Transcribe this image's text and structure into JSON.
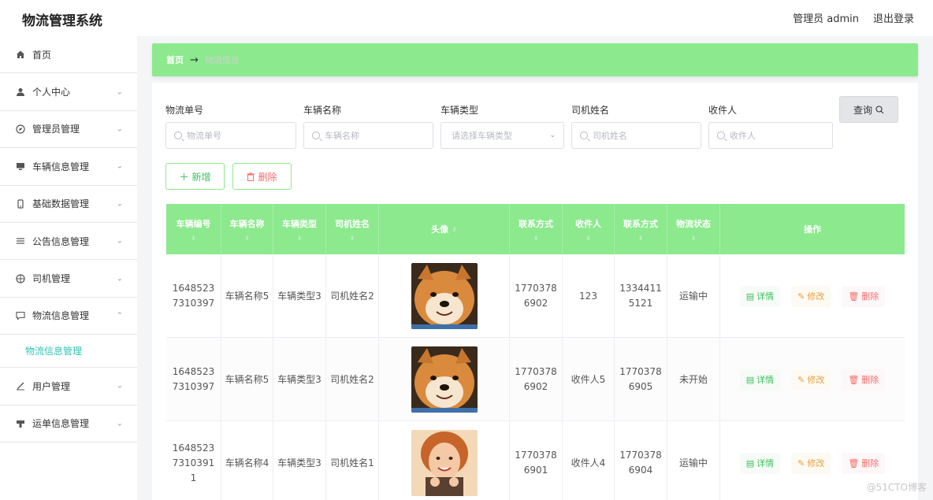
{
  "header": {
    "title": "物流管理系统",
    "user_label": "管理员 admin",
    "logout_label": "退出登录"
  },
  "sidebar": {
    "items": [
      {
        "label": "首页",
        "icon": "home-icon"
      },
      {
        "label": "个人中心",
        "icon": "user-icon"
      },
      {
        "label": "管理员管理",
        "icon": "compass-icon"
      },
      {
        "label": "车辆信息管理",
        "icon": "monitor-icon"
      },
      {
        "label": "基础数据管理",
        "icon": "phone-icon"
      },
      {
        "label": "公告信息管理",
        "icon": "list-icon"
      },
      {
        "label": "司机管理",
        "icon": "target-icon"
      },
      {
        "label": "物流信息管理",
        "icon": "message-icon"
      },
      {
        "label": "用户管理",
        "icon": "pen-icon"
      },
      {
        "label": "运单信息管理",
        "icon": "stamp-icon"
      }
    ],
    "sub_item": "物流信息管理"
  },
  "breadcrumb": {
    "home": "首页",
    "arrow": "→",
    "current": "物流信息"
  },
  "search": {
    "fields": [
      {
        "label": "物流单号",
        "placeholder": "物流单号"
      },
      {
        "label": "车辆名称",
        "placeholder": "车辆名称"
      },
      {
        "label": "车辆类型",
        "placeholder": "请选择车辆类型"
      },
      {
        "label": "司机姓名",
        "placeholder": "司机姓名"
      },
      {
        "label": "收件人",
        "placeholder": "收件人"
      }
    ],
    "query_label": "查询"
  },
  "actions": {
    "add_label": "新增",
    "delete_label": "删除"
  },
  "table": {
    "headers": [
      "车辆编号",
      "车辆名称",
      "车辆类型",
      "司机姓名",
      "头像",
      "联系方式",
      "收件人",
      "联系方式",
      "物流状态",
      "操作"
    ],
    "rows": [
      {
        "vehicle_no": "16485237310397",
        "vehicle_name": "车辆名称5",
        "vehicle_type": "车辆类型3",
        "driver": "司机姓名2",
        "avatar": "shiba-dog",
        "phone": "17703786902",
        "recipient": "123",
        "recipient_phone": "13344115121",
        "status": "运输中"
      },
      {
        "vehicle_no": "16485237310397",
        "vehicle_name": "车辆名称5",
        "vehicle_type": "车辆类型3",
        "driver": "司机姓名2",
        "avatar": "shiba-dog",
        "phone": "17703786902",
        "recipient": "收件人5",
        "recipient_phone": "17703786905",
        "status": "未开始"
      },
      {
        "vehicle_no": "164852373103911",
        "vehicle_name": "车辆名称4",
        "vehicle_type": "车辆类型3",
        "driver": "司机姓名1",
        "avatar": "smiling-girl",
        "phone": "17703786901",
        "recipient": "收件人4",
        "recipient_phone": "17703786904",
        "status": "运输中"
      }
    ],
    "op_detail": "详情",
    "op_edit": "修改",
    "op_delete": "删除"
  },
  "watermark": "@51CTO博客",
  "colors": {
    "accent_green": "#8ce98e",
    "submenu_teal": "#2fc4b2",
    "danger": "#f56c6c",
    "warning": "#e6a23c"
  }
}
